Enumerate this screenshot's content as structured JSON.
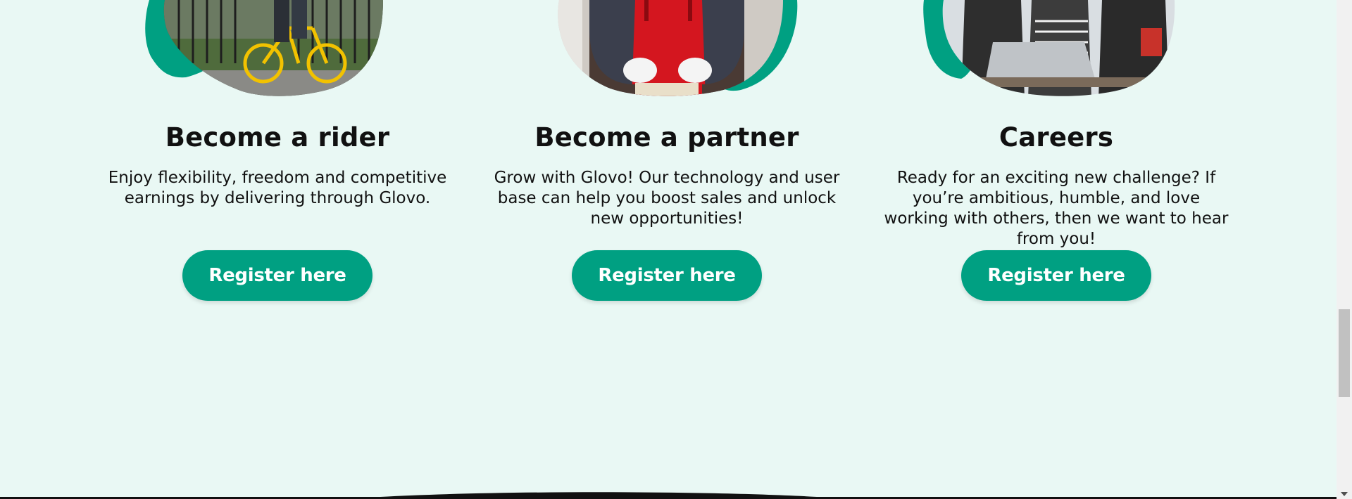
{
  "colors": {
    "page_background": "#e9f8f4",
    "brand_green": "#00a082",
    "button_text": "#ffffff",
    "heading_text": "#111111"
  },
  "cards": [
    {
      "title": "Become a rider",
      "description": "Enjoy flexibility, freedom and competitive earnings by delivering through Glovo.",
      "button_label": "Register here",
      "image_icon": "rider-photo"
    },
    {
      "title": "Become a partner",
      "description": "Grow with Glovo! Our technology and user base can help you boost sales and unlock new opportunities!",
      "button_label": "Register here",
      "image_icon": "partner-photo"
    },
    {
      "title": "Careers",
      "description": "Ready for an exciting new challenge? If you’re ambitious, humble, and love working with others, then we want to hear from you!",
      "button_label": "Register here",
      "image_icon": "careers-photo"
    }
  ]
}
